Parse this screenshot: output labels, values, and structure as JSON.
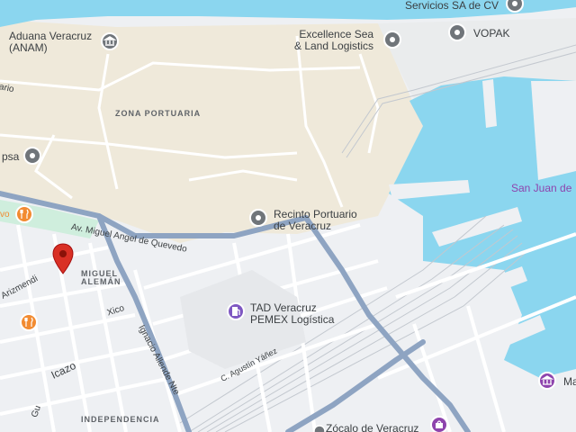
{
  "map": {
    "colors": {
      "water": "#8bd6ef",
      "port_land": "#efe9da",
      "urban": "#eef0f3",
      "street": "#ffffff",
      "highway": "#8ea4c2",
      "park": "#cfeedd",
      "pin_red": "#d93025",
      "poi_grey": "#70757a",
      "food_orange": "#f28b31",
      "shop_purple": "#8e44ad",
      "fuel_purple": "#7e57c2"
    },
    "districts": {
      "zona_portuaria": "ZONA PORTUARIA",
      "miguel_aleman": "MIGUEL\nALEMÁN",
      "independencia": "INDEPENDENCIA"
    },
    "pois": {
      "aduana": {
        "label": "Aduana Veracruz\n(ANAM)",
        "icon": "government-building-icon"
      },
      "servicios": {
        "label": "Servicios SA de CV",
        "icon": "location-icon"
      },
      "excellence": {
        "label": "Excellence Sea\n& Land Logistics",
        "icon": "location-icon"
      },
      "vopak": {
        "label": "VOPAK",
        "icon": "location-icon"
      },
      "psa": {
        "label": "psa",
        "icon": "location-icon"
      },
      "recinto": {
        "label": "Recinto Portuario\nde Veracruz",
        "icon": "location-icon"
      },
      "tad": {
        "label": "TAD Veracruz\nPEMEX Logística",
        "icon": "gas-station-icon"
      },
      "zocalo": {
        "label": "Zócalo de Veracruz",
        "icon": "shopping-icon"
      },
      "ma": {
        "label": "Ma",
        "icon": "museum-icon"
      }
    },
    "water_labels": {
      "san_juan": "San Juan de"
    },
    "streets": {
      "quevedo": "Av. Miguel Angel de Quevedo",
      "allende": "Ignacio Allende Nte",
      "arizmendi": "Arizmendi",
      "xico": "Xico",
      "icazo": "Icazo",
      "yanez": "C. Agustín Yáñez",
      "gu": "Gu",
      "ario": "ario",
      "vo": "vo"
    },
    "markers": {
      "dropped_pin": "location-pin-icon",
      "restaurant": "restaurant-icon"
    }
  }
}
